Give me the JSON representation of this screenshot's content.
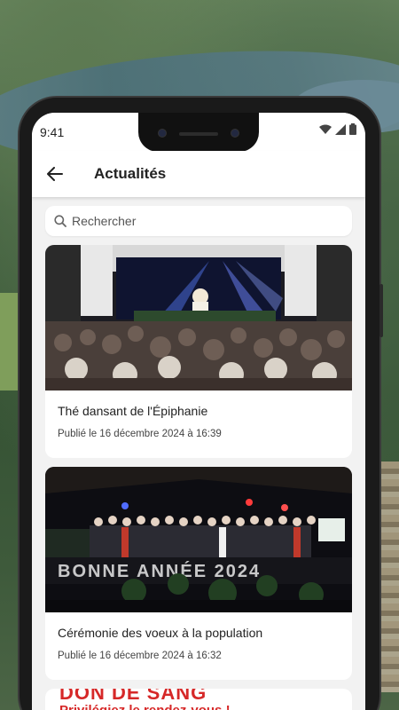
{
  "status_bar": {
    "time": "9:41"
  },
  "app_bar": {
    "title": "Actualités",
    "back_icon": "arrow-left-icon"
  },
  "search": {
    "placeholder": "Rechercher",
    "icon": "search-icon"
  },
  "news": [
    {
      "title": "Thé dansant de l'Épiphanie",
      "date": "Publié le 16 décembre 2024 à 16:39"
    },
    {
      "title": "Cérémonie des voeux à la population",
      "date": "Publié le 16 décembre 2024 à 16:32"
    }
  ],
  "promo": {
    "line1": "DON DE SANG",
    "line2": "Privilégiez le rendez-vous !"
  },
  "colors": {
    "promo_red": "#d62828",
    "screen_bg": "#f2f2f2"
  }
}
